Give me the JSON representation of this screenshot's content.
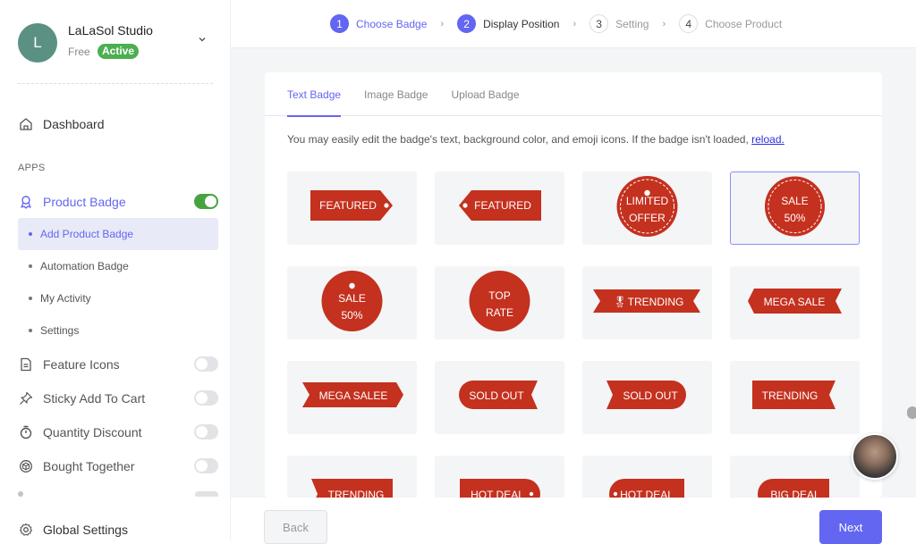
{
  "profile": {
    "avatar_initial": "L",
    "store_name": "LaLaSol Studio",
    "plan": "Free",
    "status": "Active"
  },
  "nav": {
    "dashboard": "Dashboard",
    "apps_label": "APPS",
    "global_settings": "Global Settings"
  },
  "apps": [
    {
      "label": "Product Badge",
      "icon": "ribbon-icon",
      "enabled": true,
      "active": true
    },
    {
      "label": "Feature Icons",
      "icon": "document-icon",
      "enabled": false
    },
    {
      "label": "Sticky Add To Cart",
      "icon": "pin-icon",
      "enabled": false
    },
    {
      "label": "Quantity Discount",
      "icon": "stopwatch-icon",
      "enabled": false
    },
    {
      "label": "Bought Together",
      "icon": "box-icon",
      "enabled": false
    }
  ],
  "submenu": [
    {
      "label": "Add Product Badge",
      "active": true
    },
    {
      "label": "Automation Badge"
    },
    {
      "label": "My Activity"
    },
    {
      "label": "Settings"
    }
  ],
  "stepper": [
    {
      "num": "1",
      "label": "Choose Badge",
      "state": "done"
    },
    {
      "num": "2",
      "label": "Display Position",
      "state": "current"
    },
    {
      "num": "3",
      "label": "Setting",
      "state": "pending"
    },
    {
      "num": "4",
      "label": "Choose Product",
      "state": "pending"
    }
  ],
  "tabs": [
    {
      "label": "Text Badge",
      "active": true
    },
    {
      "label": "Image Badge"
    },
    {
      "label": "Upload Badge"
    }
  ],
  "hint": {
    "text": "You may easily edit the badge's text, background color, and emoji icons. If the badge isn't loaded, ",
    "link": "reload."
  },
  "badge_color": "#c4311f",
  "accent_color": "#6366f1",
  "badges": [
    {
      "text": "FEATURED",
      "shape": "tag-right"
    },
    {
      "text": "FEATURED",
      "shape": "tag-left"
    },
    {
      "text": "LIMITED|OFFER",
      "shape": "circle-stitched-hole"
    },
    {
      "text": "SALE|50%",
      "shape": "circle-stitched",
      "selected": true
    },
    {
      "text": "SALE|50%",
      "shape": "circle-hole"
    },
    {
      "text": "TOP|RATE",
      "shape": "circle"
    },
    {
      "text": "TRENDING",
      "shape": "ribbon-both",
      "emoji": "🎖"
    },
    {
      "text": "MEGA SALE",
      "shape": "ribbon-arrow-left"
    },
    {
      "text": "MEGA SALEE",
      "shape": "ribbon-arrow-right"
    },
    {
      "text": "SOLD OUT",
      "shape": "pill-left-notch-right"
    },
    {
      "text": "SOLD OUT",
      "shape": "notch-left-pill-right"
    },
    {
      "text": "TRENDING",
      "shape": "notch-right"
    },
    {
      "text": "TRENDING",
      "shape": "notch-left"
    },
    {
      "text": "HOT DEAL",
      "shape": "pill-right-hole"
    },
    {
      "text": "HOT DEAL",
      "shape": "pill-left-hole"
    },
    {
      "text": "BIG DEAL",
      "shape": "pill-left"
    }
  ],
  "buttons": {
    "back": "Back",
    "next": "Next"
  }
}
